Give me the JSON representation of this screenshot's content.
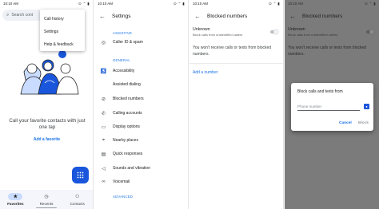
{
  "panel1": {
    "status_time": "10:10 AM",
    "status_right": "⊙ ⌃ ▮",
    "search_placeholder": "Search cont",
    "menu_items": [
      "Call history",
      "Settings",
      "Help & feedback"
    ],
    "empty_message": "Call your favorite contacts with just one tap",
    "add_favorite": "Add a favorite",
    "nav": [
      {
        "label": "Favorites",
        "icon": "star-icon",
        "active": true
      },
      {
        "label": "Recents",
        "icon": "clock-icon",
        "active": false
      },
      {
        "label": "Contacts",
        "icon": "people-icon",
        "active": false
      }
    ]
  },
  "panel2": {
    "status_time": "10:10 AM",
    "status_right": "⊙ ⌃ ▮",
    "title": "Settings",
    "sections": {
      "assistive": "ASSISTIVE",
      "general": "GENERAL",
      "advanced": "ADVANCED"
    },
    "assistive_items": [
      "Caller ID & spam"
    ],
    "general_items": [
      "Accessibility",
      "Assisted dialing",
      "Blocked numbers",
      "Calling accounts",
      "Display options",
      "Nearby places",
      "Quick responses",
      "Sounds and vibration",
      "Voicemail"
    ]
  },
  "panel3": {
    "status_time": "10:10 AM",
    "status_right": "⊙ ⌃ ▮",
    "title": "Blocked numbers",
    "unknown_title": "Unknown",
    "unknown_sub": "Block calls from unidentified callers",
    "no_receive": "You won't receive calls or texts from blocked numbers.",
    "add_number": "Add a number"
  },
  "panel4": {
    "status_time": "10:10 AM",
    "status_right": "⊙ ⌃ ▮",
    "title": "Blocked numbers",
    "unknown_title": "Unknown",
    "unknown_sub": "Block calls from unidentified callers",
    "no_receive": "You won't receive calls or texts from blocked numbers.",
    "dialog": {
      "title": "Block calls and texts from",
      "placeholder": "Phone number",
      "cancel": "Cancel",
      "block": "Block"
    }
  },
  "colors": {
    "accent": "#1a73e8",
    "fab": "#1a56db",
    "scrim": "#7b7b7b",
    "active_pill": "#c9dcff"
  }
}
